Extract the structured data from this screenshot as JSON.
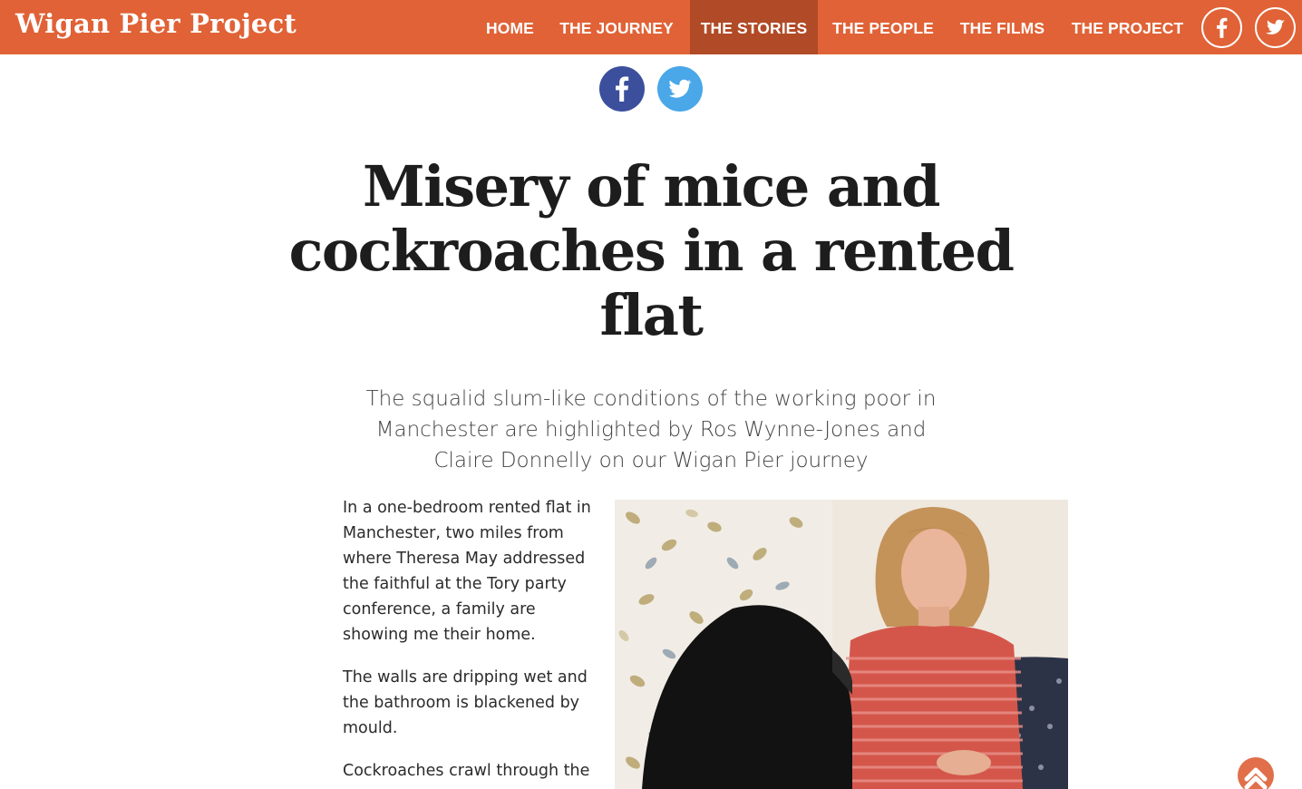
{
  "site": {
    "brand": "Wigan Pier Project",
    "brand_color": "#e06236",
    "active_nav_color": "#b14a26"
  },
  "nav": {
    "items": [
      {
        "label": "HOME",
        "active": false
      },
      {
        "label": "THE JOURNEY",
        "active": false
      },
      {
        "label": "THE STORIES",
        "active": true
      },
      {
        "label": "THE PEOPLE",
        "active": false
      },
      {
        "label": "THE FILMS",
        "active": false
      },
      {
        "label": "THE PROJECT",
        "active": false
      }
    ],
    "social_icons": [
      "facebook-icon",
      "twitter-icon"
    ]
  },
  "share": {
    "icons": [
      "facebook-icon",
      "twitter-icon"
    ],
    "facebook_color": "#3b4f9d",
    "twitter_color": "#4aa7e8"
  },
  "article": {
    "headline": "Misery of mice and cockroaches in a rented flat",
    "standfirst": "The squalid slum-like conditions of the working poor in Manchester are highlighted by Ros Wynne-Jones and Claire Donnelly on our Wigan Pier journey",
    "paragraphs": [
      "In a one-bedroom rented flat in Manchester, two miles from where Theresa May addressed the faithful at the Tory party conference, a family are showing me their home.",
      "The walls are dripping wet and the bathroom is blackened by mould.",
      "Cockroaches crawl through the"
    ]
  },
  "back_to_top": {
    "icon": "chevron-up-icon"
  }
}
